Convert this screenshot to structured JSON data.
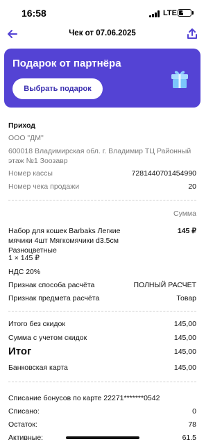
{
  "status_bar": {
    "time": "16:58",
    "network": "LTE",
    "battery": "40",
    "battery_level": 0.4
  },
  "nav": {
    "title": "Чек от 07.06.2025",
    "back_icon": "arrow-left-icon",
    "share_icon": "share-icon",
    "accent_color": "#5443d4"
  },
  "promo": {
    "title": "Подарок от партнёра",
    "button_label": "Выбрать подарок",
    "background_color": "#5443d4",
    "icon": "gift-icon"
  },
  "receipt": {
    "operation": "Приход",
    "organization": "ООО \"ДМ\"",
    "address": "600018  Владимирская обл.  г. Владимир ТЦ Районный  этаж №1  Зоозавр",
    "register_label": "Номер кассы",
    "register_value": "7281440701454990",
    "receipt_no_label": "Номер чека продажи",
    "receipt_no_value": "20",
    "sum_header": "Сумма",
    "item": {
      "name": "Набор для кошек Barbaks Легкие мячики 4шт Мягкомячики d3.5см Разноцветные",
      "price": "145 ₽",
      "qty_line": "1 × 145 ₽",
      "vat": "НДС 20%",
      "payment_method_label": "Признак способа расчёта",
      "payment_method_value": "ПОЛНЫЙ РАСЧЕТ",
      "subject_label": "Признак предмета расчёта",
      "subject_value": "Товар"
    },
    "totals": {
      "no_discount_label": "Итого без скидок",
      "no_discount_value": "145,00",
      "with_discount_label": "Сумма с учетом скидок",
      "with_discount_value": "145,00",
      "total_label": "Итог",
      "total_value": "145,00",
      "card_label": "Банковская карта",
      "card_value": "145,00"
    },
    "bonus": {
      "header": "Списание бонусов по карте 22271*******0542",
      "spent_label": "Списано:",
      "spent_value": "0",
      "balance_label": "Остаток:",
      "balance_value": "78",
      "active_label": "Активные:",
      "active_value": "61.5"
    }
  }
}
